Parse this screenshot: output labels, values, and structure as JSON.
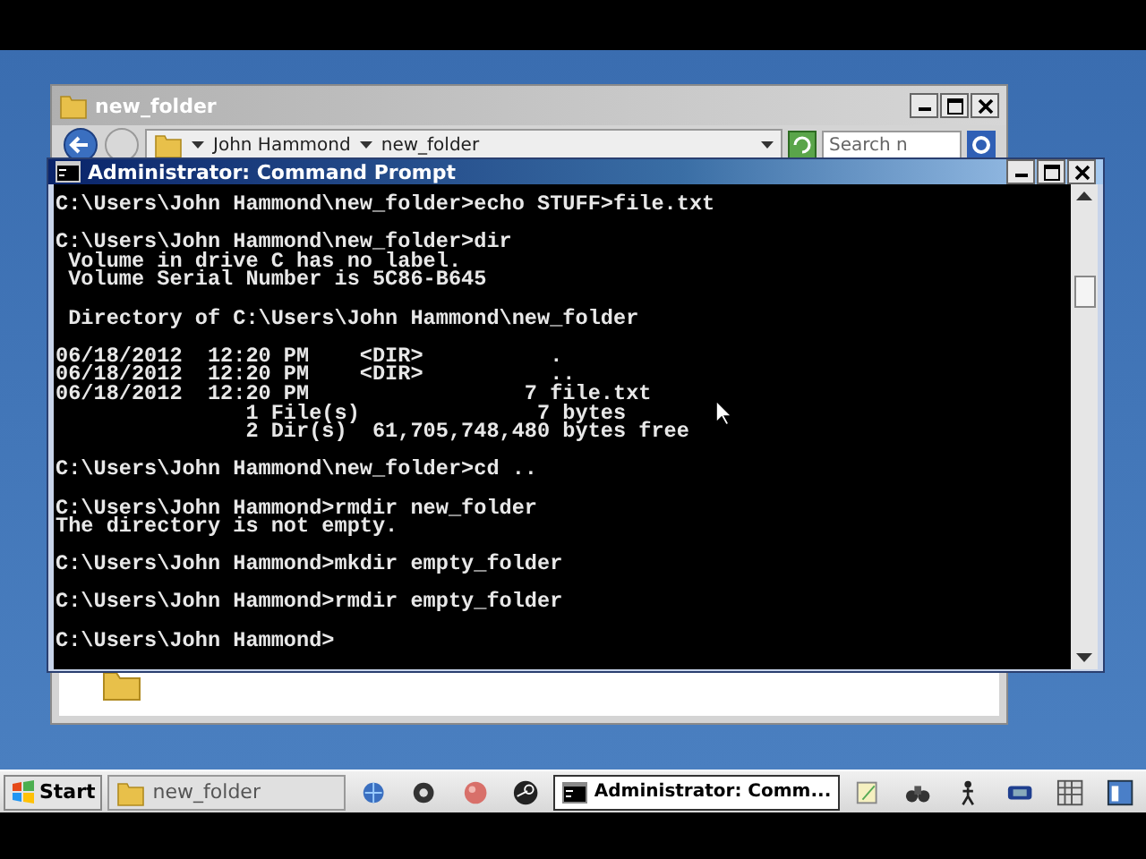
{
  "explorer": {
    "title": "new_folder",
    "breadcrumb": [
      "John Hammond",
      "new_folder"
    ],
    "search": {
      "placeholder": "Search n"
    }
  },
  "console": {
    "title": "Administrator: Command Prompt",
    "blocks": [
      [
        "C:\\Users\\John Hammond\\new_folder>echo STUFF>file.txt"
      ],
      [
        "C:\\Users\\John Hammond\\new_folder>dir",
        " Volume in drive C has no label.",
        " Volume Serial Number is 5C86-B645"
      ],
      [
        " Directory of C:\\Users\\John Hammond\\new_folder"
      ],
      [
        "06/18/2012  12:20 PM    <DIR>          .",
        "06/18/2012  12:20 PM    <DIR>          ..",
        "06/18/2012  12:20 PM                 7 file.txt",
        "               1 File(s)              7 bytes",
        "               2 Dir(s)  61,705,748,480 bytes free"
      ],
      [
        "C:\\Users\\John Hammond\\new_folder>cd .."
      ],
      [
        "C:\\Users\\John Hammond>rmdir new_folder",
        "The directory is not empty."
      ],
      [
        "C:\\Users\\John Hammond>mkdir empty_folder"
      ],
      [
        "C:\\Users\\John Hammond>rmdir empty_folder"
      ],
      [
        "C:\\Users\\John Hammond>"
      ]
    ]
  },
  "taskbar": {
    "start": "Start",
    "buttons": [
      {
        "label": "new_folder",
        "kind": "explorer",
        "selected": false
      },
      {
        "label": "Administrator: Comm...",
        "kind": "console",
        "selected": true
      }
    ]
  }
}
